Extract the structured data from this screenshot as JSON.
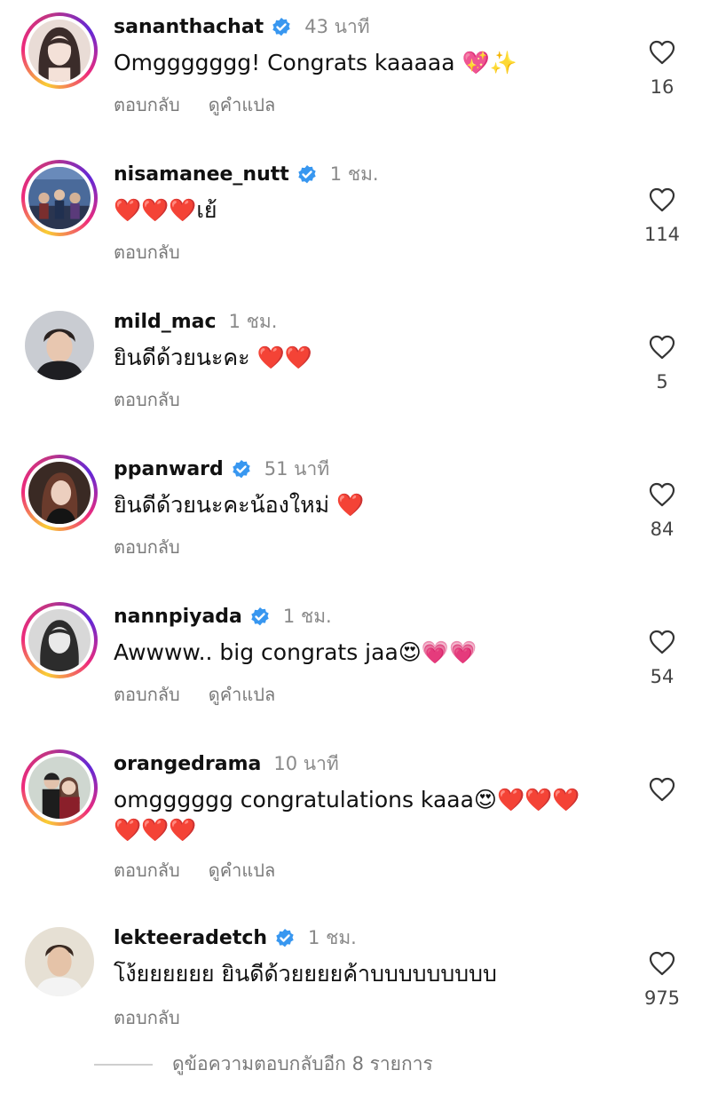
{
  "comments": [
    {
      "username": "sananthachat",
      "verified": true,
      "time": "43 นาที",
      "text": "Omggggggg! Congrats kaaaaa 💖✨",
      "reply": "ตอบกลับ",
      "translate": "ดูคำแปล",
      "likes": "16"
    },
    {
      "username": "nisamanee_nutt",
      "verified": true,
      "time": "1 ชม.",
      "text": "❤️❤️❤️เย้",
      "reply": "ตอบกลับ",
      "translate": "",
      "likes": "114"
    },
    {
      "username": "mild_mac",
      "verified": false,
      "time": "1 ชม.",
      "text": "ยินดีด้วยนะคะ ❤️❤️",
      "reply": "ตอบกลับ",
      "translate": "",
      "likes": "5"
    },
    {
      "username": "ppanward",
      "verified": true,
      "time": "51 นาที",
      "text": "ยินดีด้วยนะคะน้องใหม่ ❤️",
      "reply": "ตอบกลับ",
      "translate": "",
      "likes": "84"
    },
    {
      "username": "nannpiyada",
      "verified": true,
      "time": "1 ชม.",
      "text": "Awwww.. big congrats jaa😍💗💗",
      "reply": "ตอบกลับ",
      "translate": "ดูคำแปล",
      "likes": "54"
    },
    {
      "username": "orangedrama",
      "verified": false,
      "time": "10 นาที",
      "text": "omgggggg congratulations kaaa😍❤️❤️❤️ ❤️❤️❤️",
      "reply": "ตอบกลับ",
      "translate": "ดูคำแปล",
      "likes": ""
    },
    {
      "username": "lekteeradetch",
      "verified": true,
      "time": "1 ชม.",
      "text": "โง้ยยยยยย ยินดีด้วยยยยค้าบบบบบบบบบ",
      "reply": "ตอบกลับ",
      "translate": "",
      "likes": "975"
    }
  ],
  "view_more_replies": "ดูข้อความตอบกลับอีก 8 รายการ",
  "colors": {
    "verified": "#3897f0",
    "muted": "#8a8a8a",
    "story_ring": "#ee2a7b"
  },
  "icons": {
    "like": "heart-outline-icon",
    "verified": "verified-badge-icon"
  }
}
